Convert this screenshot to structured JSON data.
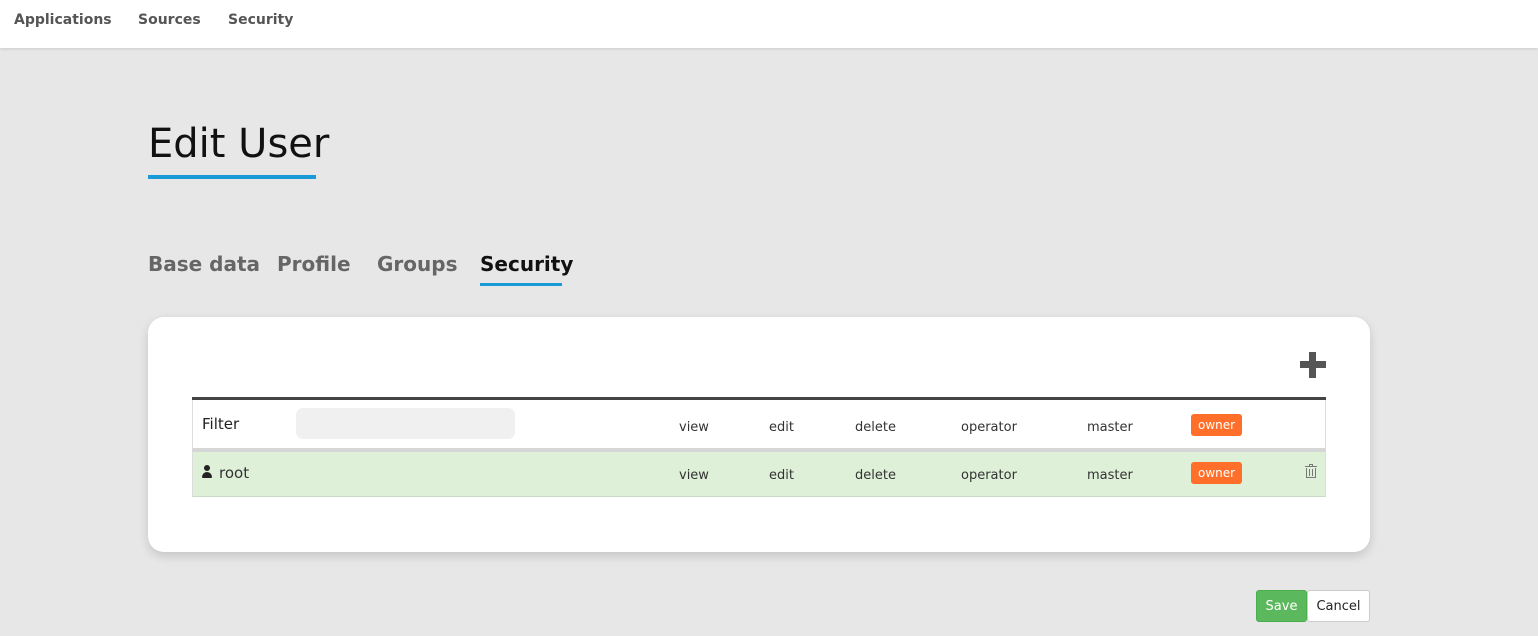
{
  "nav": {
    "items": [
      {
        "label": "Applications"
      },
      {
        "label": "Sources"
      },
      {
        "label": "Security"
      }
    ]
  },
  "page": {
    "title": "Edit User"
  },
  "tabs": [
    {
      "label": "Base data",
      "active": false
    },
    {
      "label": "Profile",
      "active": false
    },
    {
      "label": "Groups",
      "active": false
    },
    {
      "label": "Security",
      "active": true
    }
  ],
  "table": {
    "filter_label": "Filter",
    "filter_value": "",
    "header_permissions": {
      "view": "view",
      "edit": "edit",
      "delete": "delete",
      "operator": "operator",
      "master": "master",
      "owner": "owner"
    },
    "rows": [
      {
        "user": "root",
        "view": "view",
        "edit": "edit",
        "delete": "delete",
        "operator": "operator",
        "master": "master",
        "owner": "owner"
      }
    ]
  },
  "icons": {
    "add": "plus-icon",
    "user": "user-icon",
    "delete": "trash-icon"
  },
  "colors": {
    "accent": "#1a9bd7",
    "owner_badge": "#ff6f2a",
    "save_button": "#5cb85c",
    "row_highlight": "#dff0d8"
  },
  "footer": {
    "save_label": "Save",
    "cancel_label": "Cancel"
  }
}
